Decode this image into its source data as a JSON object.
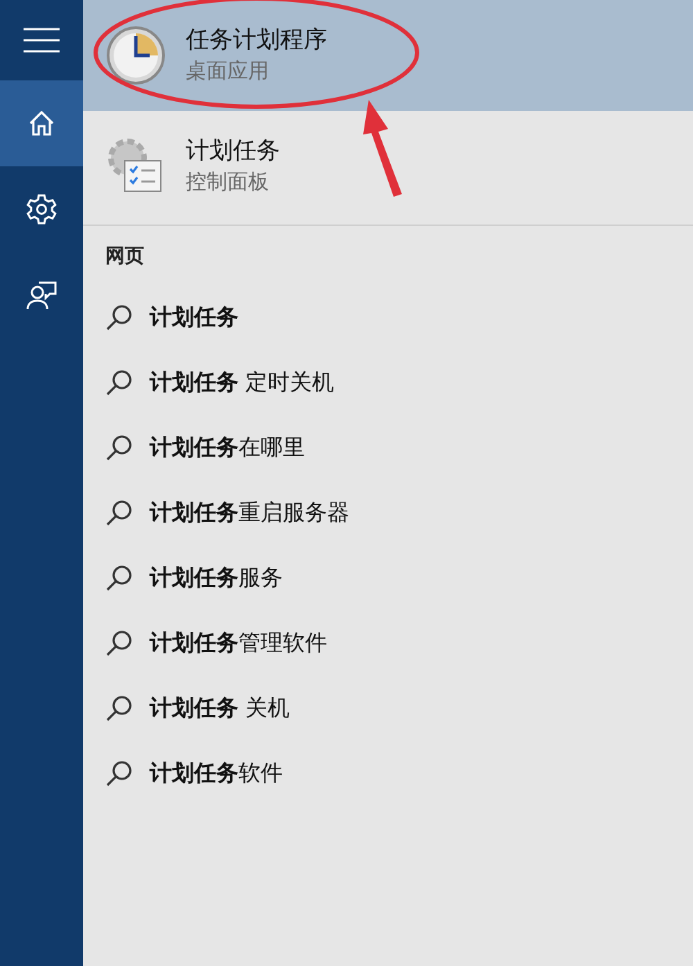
{
  "sidebar": {
    "items": [
      {
        "kind": "menu",
        "selected": false
      },
      {
        "kind": "home",
        "selected": true
      },
      {
        "kind": "settings",
        "selected": false
      },
      {
        "kind": "feedback",
        "selected": false
      }
    ]
  },
  "results": [
    {
      "kind": "clock",
      "title": "任务计划程序",
      "subtitle": "桌面应用",
      "selected": true
    },
    {
      "kind": "control",
      "title": "计划任务",
      "subtitle": "控制面板",
      "selected": false
    }
  ],
  "web": {
    "heading": "网页",
    "suggestions": [
      {
        "match": "计划任务"
      },
      {
        "match": "计划任务",
        "rest": " 定时关机"
      },
      {
        "match": "计划任务",
        "rest": "在哪里"
      },
      {
        "match": "计划任务",
        "rest": "重启服务器"
      },
      {
        "match": "计划任务",
        "rest": "服务"
      },
      {
        "match": "计划任务",
        "rest": "管理软件"
      },
      {
        "match": "计划任务",
        "rest": " 关机"
      },
      {
        "match": "计划任务",
        "rest": "软件"
      }
    ]
  }
}
